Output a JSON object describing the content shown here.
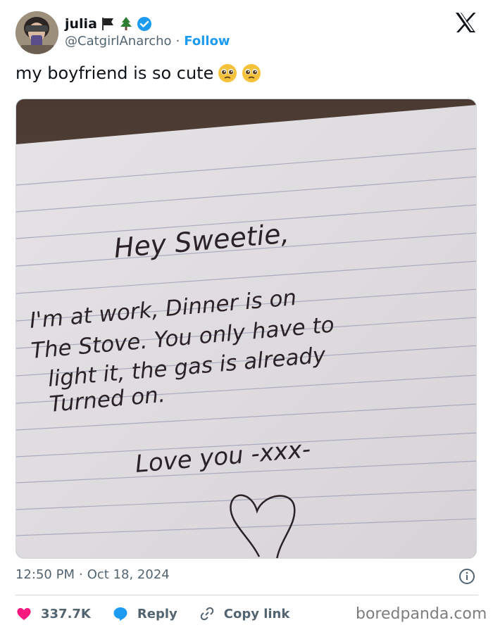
{
  "header": {
    "display_name": "julia",
    "handle": "@CatgirlAnarcho",
    "separator": "·",
    "follow_label": "Follow"
  },
  "tweet": {
    "text": "my boyfriend is so cute",
    "emoji": [
      "pleading-face",
      "pleading-face"
    ]
  },
  "note": {
    "line1": "Hey Sweetie,",
    "line2": "I'm at work, Dinner is on",
    "line3": "The Stove. You only have to",
    "line4": "light it, the gas is already",
    "line5": "Turned on.",
    "line6": "Love you -xxx-"
  },
  "meta": {
    "time": "12:50 PM",
    "separator": "·",
    "date": "Oct 18, 2024"
  },
  "actions": {
    "likes": "337.7K",
    "reply_label": "Reply",
    "copy_label": "Copy link"
  },
  "watermark": "boredpanda.com",
  "colors": {
    "accent": "#1d9bf0",
    "like": "#f91880",
    "muted": "#536471"
  }
}
